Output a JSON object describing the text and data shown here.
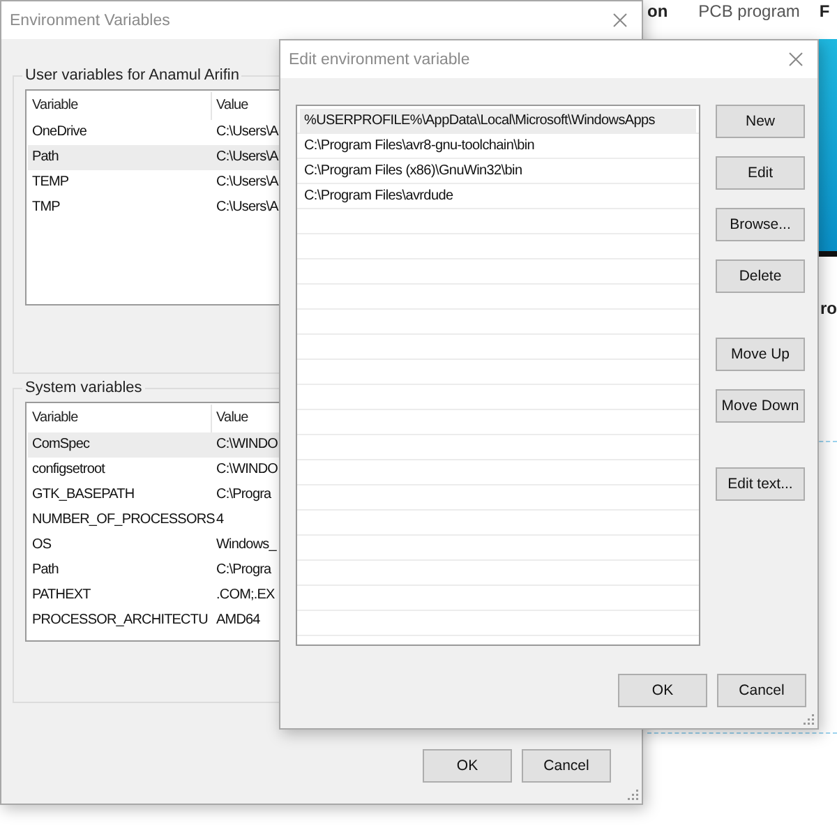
{
  "background_page": {
    "nav": [
      "on",
      "PCB program",
      "F"
    ],
    "heading_fragment": "ro"
  },
  "main_window": {
    "title": "Environment Variables",
    "user_group": {
      "label": "User variables for Anamul Arifin",
      "columns": [
        "Variable",
        "Value"
      ],
      "rows": [
        {
          "variable": "OneDrive",
          "value": "C:\\Users\\A",
          "selected": false
        },
        {
          "variable": "Path",
          "value": "C:\\Users\\A",
          "selected": true
        },
        {
          "variable": "TEMP",
          "value": "C:\\Users\\A",
          "selected": false
        },
        {
          "variable": "TMP",
          "value": "C:\\Users\\A",
          "selected": false
        }
      ]
    },
    "system_group": {
      "label": "System variables",
      "columns": [
        "Variable",
        "Value"
      ],
      "rows": [
        {
          "variable": "ComSpec",
          "value": "C:\\WINDO",
          "selected": true
        },
        {
          "variable": "configsetroot",
          "value": "C:\\WINDO",
          "selected": false
        },
        {
          "variable": "GTK_BASEPATH",
          "value": "C:\\Progra",
          "selected": false
        },
        {
          "variable": "NUMBER_OF_PROCESSORS",
          "value": "4",
          "selected": false
        },
        {
          "variable": "OS",
          "value": "Windows_",
          "selected": false
        },
        {
          "variable": "Path",
          "value": "C:\\Progra",
          "selected": false
        },
        {
          "variable": "PATHEXT",
          "value": ".COM;.EX",
          "selected": false
        },
        {
          "variable": "PROCESSOR_ARCHITECTU",
          "value": "AMD64",
          "selected": false
        }
      ]
    },
    "buttons": [
      "OK",
      "Cancel"
    ]
  },
  "edit_dialog": {
    "title": "Edit environment variable",
    "entries": [
      {
        "text": "%USERPROFILE%\\AppData\\Local\\Microsoft\\WindowsApps",
        "selected": true
      },
      {
        "text": "C:\\Program Files\\avr8-gnu-toolchain\\bin",
        "selected": false
      },
      {
        "text": "C:\\Program Files (x86)\\GnuWin32\\bin",
        "selected": false
      },
      {
        "text": "C:\\Program Files\\avrdude",
        "selected": false
      }
    ],
    "side_button_groups": [
      [
        "New",
        "Edit",
        "Browse...",
        "Delete"
      ],
      [
        "Move Up",
        "Move Down"
      ],
      [
        "Edit text..."
      ]
    ],
    "buttons": [
      "OK",
      "Cancel"
    ]
  }
}
